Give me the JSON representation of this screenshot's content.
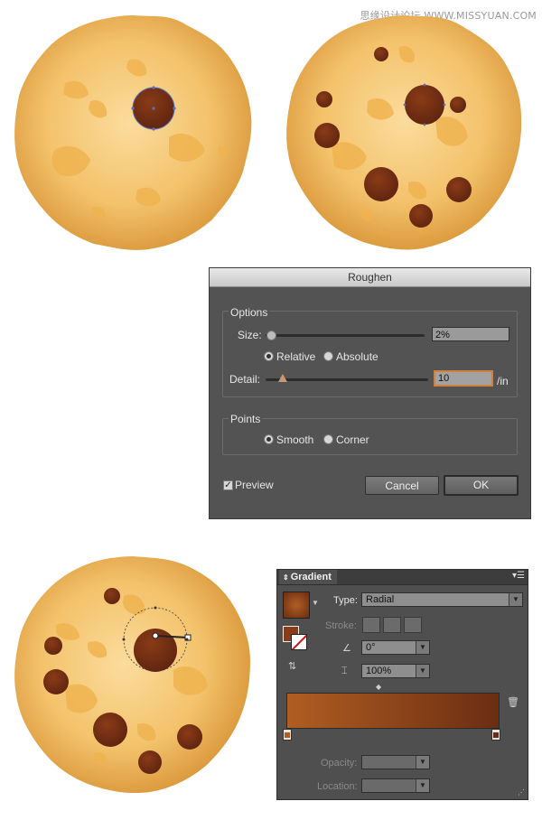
{
  "watermark": "思缘设计论坛 WWW.MISSYUAN.COM",
  "roughen_dialog": {
    "title": "Roughen",
    "options_group": "Options",
    "size_label": "Size:",
    "size_value": "2%",
    "size_slider_fraction": 0.02,
    "relative_label": "Relative",
    "absolute_label": "Absolute",
    "size_mode_selected": "Relative",
    "detail_label": "Detail:",
    "detail_value": "10",
    "detail_unit": "/in",
    "points_group": "Points",
    "smooth_label": "Smooth",
    "corner_label": "Corner",
    "points_selected": "Smooth",
    "preview_label": "Preview",
    "preview_checked": true,
    "cancel_label": "Cancel",
    "ok_label": "OK"
  },
  "gradient_panel": {
    "tab_label": "Gradient",
    "type_label": "Type:",
    "type_value": "Radial",
    "stroke_label": "Stroke:",
    "angle_value": "0°",
    "aspect_value": "100%",
    "opacity_label": "Opacity:",
    "location_label": "Location:",
    "gradient_colors": [
      "#b05e22",
      "#6b2d12"
    ],
    "fill_swatch_color": "#8a3b17"
  },
  "icons": [
    "chevron-down-icon",
    "angle-icon",
    "aspect-ratio-icon",
    "trash-icon",
    "panel-menu-icon",
    "reverse-gradient-icon"
  ]
}
